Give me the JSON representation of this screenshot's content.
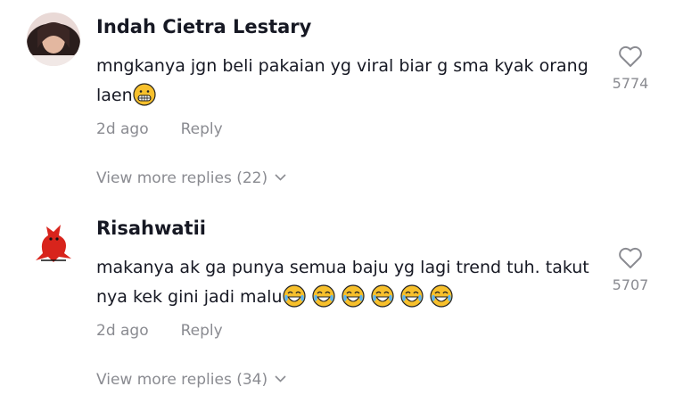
{
  "comments": [
    {
      "username": "Indah Cietra Lestary",
      "text": "mngkanya jgn beli pakaian yg viral biar g sma kyak orang laen",
      "emojis": [
        "grinning-face-with-teeth"
      ],
      "time": "2d ago",
      "reply_label": "Reply",
      "likes": "5774",
      "view_more": "View more replies (22)"
    },
    {
      "username": "Risahwatii",
      "text": "makanya ak ga punya semua baju yg lagi trend tuh. takut nya kek gini jadi malu",
      "emojis": [
        "tears-of-joy",
        "tears-of-joy",
        "tears-of-joy",
        "tears-of-joy",
        "tears-of-joy",
        "tears-of-joy"
      ],
      "time": "2d ago",
      "reply_label": "Reply",
      "likes": "5707",
      "view_more": "View more replies (34)"
    }
  ],
  "icons": {
    "like": "heart-outline-icon",
    "expand": "chevron-down-icon"
  },
  "colors": {
    "text": "#161823",
    "muted": "#8a8b91",
    "emoji_yellow": "#f7c02c"
  }
}
